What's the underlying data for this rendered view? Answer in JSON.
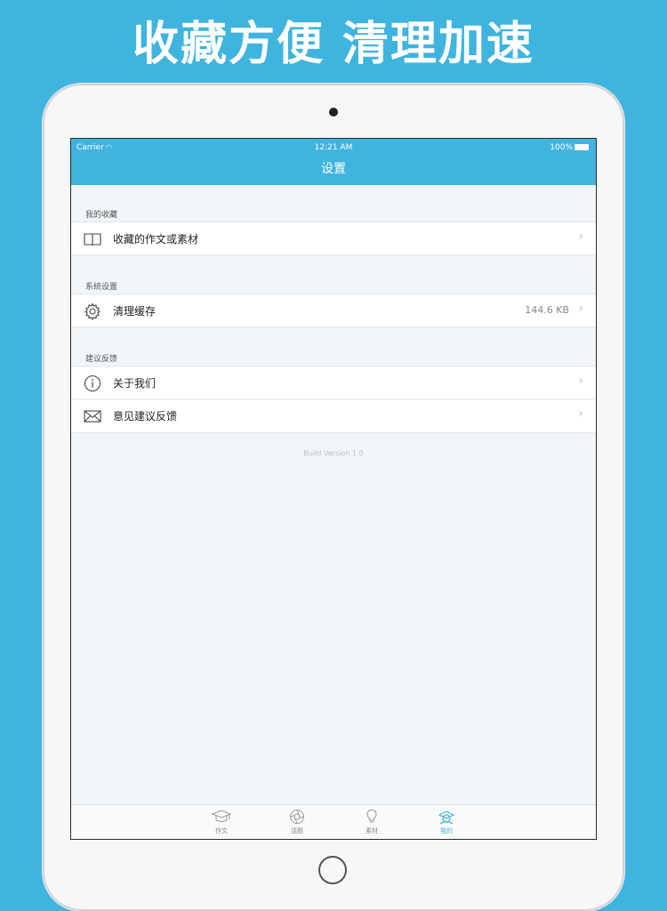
{
  "promo": {
    "headline": "收藏方便 清理加速"
  },
  "status_bar": {
    "carrier": "Carrier",
    "time": "12:21 AM",
    "battery": "100%"
  },
  "nav": {
    "title": "设置"
  },
  "sections": [
    {
      "header": "我的收藏",
      "rows": [
        {
          "label": "收藏的作文或素材",
          "icon": "book-icon",
          "value": ""
        }
      ]
    },
    {
      "header": "系统设置",
      "rows": [
        {
          "label": "清理缓存",
          "icon": "gear-icon",
          "value": "144.6 KB"
        }
      ]
    },
    {
      "header": "建议反馈",
      "rows": [
        {
          "label": "关于我们",
          "icon": "info-icon",
          "value": ""
        },
        {
          "label": "意见建议反馈",
          "icon": "mail-icon",
          "value": ""
        }
      ]
    }
  ],
  "build_version": "Build Version 1.0",
  "tabs": [
    {
      "label": "作文",
      "icon": "graduation-cap-icon"
    },
    {
      "label": "话题",
      "icon": "aperture-icon"
    },
    {
      "label": "素材",
      "icon": "lightbulb-icon"
    },
    {
      "label": "我的",
      "icon": "user-icon",
      "active": true
    }
  ],
  "colors": {
    "accent": "#41b3df",
    "background": "#3fb4df"
  }
}
